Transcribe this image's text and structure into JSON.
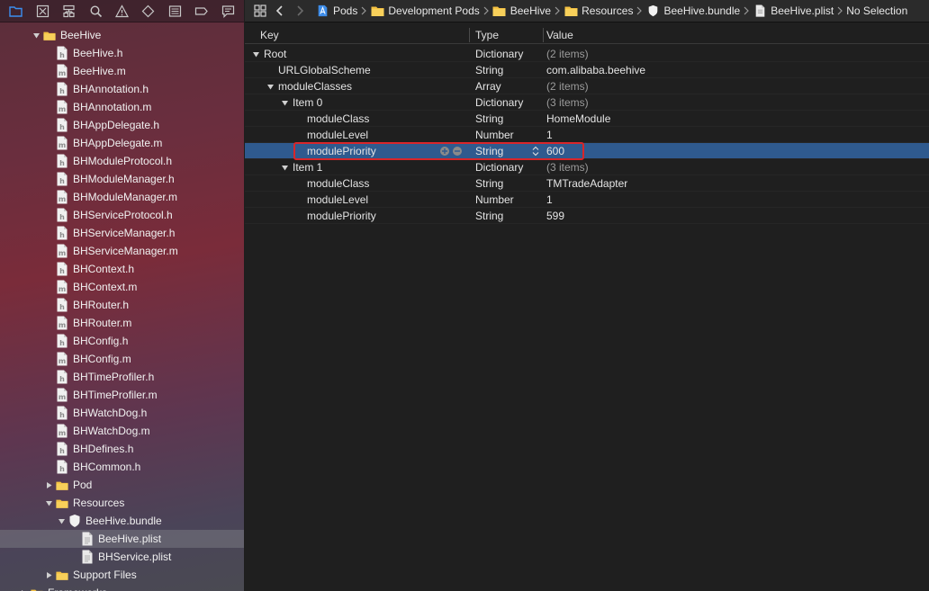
{
  "navigator": {
    "toolbar": [
      "folder-icon",
      "source-control-icon",
      "hierarchy-icon",
      "search-icon",
      "warning-icon",
      "test-icon",
      "debug-icon",
      "breakpoint-icon",
      "report-icon"
    ],
    "tree": [
      {
        "label": "BeeHive",
        "kind": "folder",
        "indent": 0,
        "open": true
      },
      {
        "label": "BeeHive.h",
        "kind": "h",
        "indent": 1
      },
      {
        "label": "BeeHive.m",
        "kind": "m",
        "indent": 1
      },
      {
        "label": "BHAnnotation.h",
        "kind": "h",
        "indent": 1
      },
      {
        "label": "BHAnnotation.m",
        "kind": "m",
        "indent": 1
      },
      {
        "label": "BHAppDelegate.h",
        "kind": "h",
        "indent": 1
      },
      {
        "label": "BHAppDelegate.m",
        "kind": "m",
        "indent": 1
      },
      {
        "label": "BHModuleProtocol.h",
        "kind": "h",
        "indent": 1
      },
      {
        "label": "BHModuleManager.h",
        "kind": "h",
        "indent": 1
      },
      {
        "label": "BHModuleManager.m",
        "kind": "m",
        "indent": 1
      },
      {
        "label": "BHServiceProtocol.h",
        "kind": "h",
        "indent": 1
      },
      {
        "label": "BHServiceManager.h",
        "kind": "h",
        "indent": 1
      },
      {
        "label": "BHServiceManager.m",
        "kind": "m",
        "indent": 1
      },
      {
        "label": "BHContext.h",
        "kind": "h",
        "indent": 1
      },
      {
        "label": "BHContext.m",
        "kind": "m",
        "indent": 1
      },
      {
        "label": "BHRouter.h",
        "kind": "h",
        "indent": 1
      },
      {
        "label": "BHRouter.m",
        "kind": "m",
        "indent": 1
      },
      {
        "label": "BHConfig.h",
        "kind": "h",
        "indent": 1
      },
      {
        "label": "BHConfig.m",
        "kind": "m",
        "indent": 1
      },
      {
        "label": "BHTimeProfiler.h",
        "kind": "h",
        "indent": 1
      },
      {
        "label": "BHTimeProfiler.m",
        "kind": "m",
        "indent": 1
      },
      {
        "label": "BHWatchDog.h",
        "kind": "h",
        "indent": 1
      },
      {
        "label": "BHWatchDog.m",
        "kind": "m",
        "indent": 1
      },
      {
        "label": "BHDefines.h",
        "kind": "h",
        "indent": 1
      },
      {
        "label": "BHCommon.h",
        "kind": "h",
        "indent": 1
      },
      {
        "label": "Pod",
        "kind": "folder",
        "indent": 1,
        "open": false
      },
      {
        "label": "Resources",
        "kind": "folder",
        "indent": 1,
        "open": true
      },
      {
        "label": "BeeHive.bundle",
        "kind": "bundle",
        "indent": 2,
        "open": true
      },
      {
        "label": "BeeHive.plist",
        "kind": "plist",
        "indent": 3,
        "selected": true
      },
      {
        "label": "BHService.plist",
        "kind": "plist",
        "indent": 3
      },
      {
        "label": "Support Files",
        "kind": "folder",
        "indent": 1,
        "open": false
      },
      {
        "label": "Frameworks",
        "kind": "folder",
        "indent": -1,
        "open": false
      }
    ]
  },
  "jump_bar": {
    "crumbs": [
      {
        "label": "Pods",
        "icon": "project"
      },
      {
        "label": "Development Pods",
        "icon": "folder"
      },
      {
        "label": "BeeHive",
        "icon": "folder"
      },
      {
        "label": "Resources",
        "icon": "folder"
      },
      {
        "label": "BeeHive.bundle",
        "icon": "bundle"
      },
      {
        "label": "BeeHive.plist",
        "icon": "plist"
      },
      {
        "label": "No Selection",
        "icon": ""
      }
    ]
  },
  "plist": {
    "headers": {
      "key": "Key",
      "type": "Type",
      "value": "Value"
    },
    "rows": [
      {
        "key": "Root",
        "type": "Dictionary",
        "value": "(2 items)",
        "depth": 0,
        "tri": "open",
        "dim": true
      },
      {
        "key": "URLGlobalScheme",
        "type": "String",
        "value": "com.alibaba.beehive",
        "depth": 1
      },
      {
        "key": "moduleClasses",
        "type": "Array",
        "value": "(2 items)",
        "depth": 1,
        "tri": "open",
        "dim": true
      },
      {
        "key": "Item 0",
        "type": "Dictionary",
        "value": "(3 items)",
        "depth": 2,
        "tri": "open",
        "dim": true
      },
      {
        "key": "moduleClass",
        "type": "String",
        "value": "HomeModule",
        "depth": 3
      },
      {
        "key": "moduleLevel",
        "type": "Number",
        "value": "1",
        "depth": 3
      },
      {
        "key": "modulePriority",
        "type": "String",
        "value": "600",
        "depth": 3,
        "selected": true
      },
      {
        "key": "Item 1",
        "type": "Dictionary",
        "value": "(3 items)",
        "depth": 2,
        "tri": "open",
        "dim": true
      },
      {
        "key": "moduleClass",
        "type": "String",
        "value": "TMTradeAdapter",
        "depth": 3
      },
      {
        "key": "moduleLevel",
        "type": "Number",
        "value": "1",
        "depth": 3
      },
      {
        "key": "modulePriority",
        "type": "String",
        "value": "599",
        "depth": 3
      }
    ]
  },
  "colors": {
    "selection": "#2f5a8e",
    "folder": "#f5c242",
    "highlight": "#d8262a"
  }
}
